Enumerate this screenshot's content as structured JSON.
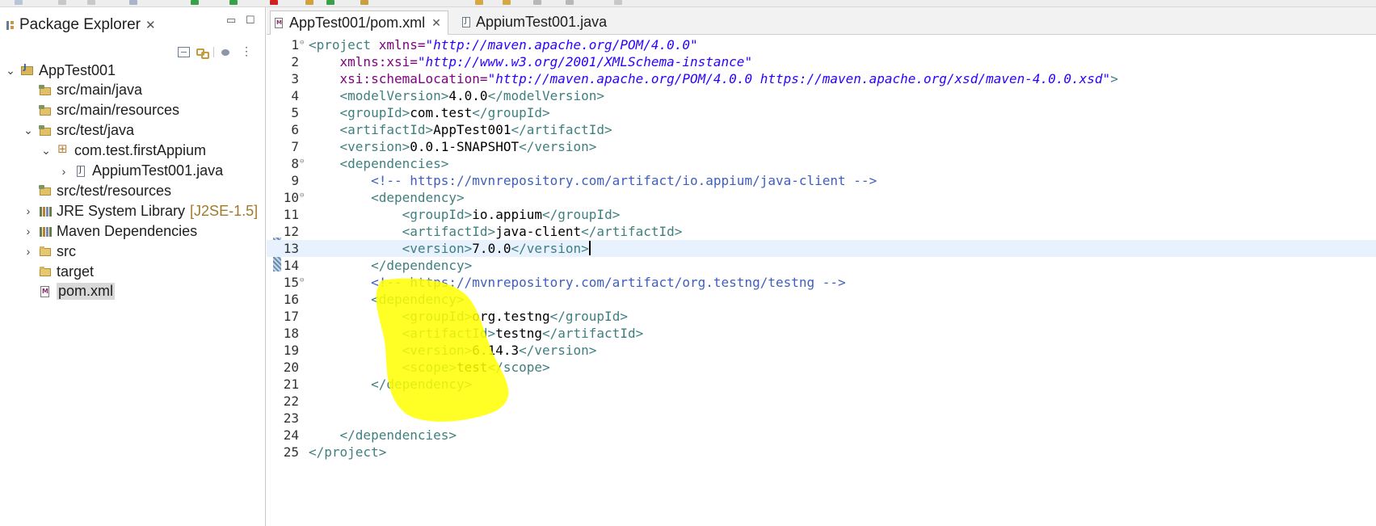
{
  "explorer": {
    "title": "Package Explorer",
    "close": "✕",
    "minimize": "▭",
    "maximize": "☐",
    "tree": [
      {
        "label": "AppTest001",
        "icon": "project-icon",
        "chevron": "⌄",
        "depth": 0
      },
      {
        "label": "src/main/java",
        "icon": "source-folder-icon",
        "chevron": "",
        "depth": 1
      },
      {
        "label": "src/main/resources",
        "icon": "source-folder-icon",
        "chevron": "",
        "depth": 1
      },
      {
        "label": "src/test/java",
        "icon": "source-folder-icon",
        "chevron": "⌄",
        "depth": 1
      },
      {
        "label": "com.test.firstAppium",
        "icon": "package-icon",
        "chevron": "⌄",
        "depth": 2
      },
      {
        "label": "AppiumTest001.java",
        "icon": "java-file-icon",
        "chevron": "›",
        "depth": 3
      },
      {
        "label": "src/test/resources",
        "icon": "source-folder-icon",
        "chevron": "",
        "depth": 1
      },
      {
        "label": "JRE System Library",
        "decoration": "[J2SE-1.5]",
        "icon": "library-icon",
        "chevron": "›",
        "depth": 1
      },
      {
        "label": "Maven Dependencies",
        "icon": "library-icon",
        "chevron": "›",
        "depth": 1
      },
      {
        "label": "src",
        "icon": "folder-icon",
        "chevron": "›",
        "depth": 1
      },
      {
        "label": "target",
        "icon": "folder-icon",
        "chevron": "",
        "depth": 1
      },
      {
        "label": "pom.xml",
        "icon": "xml-file-icon",
        "chevron": "",
        "depth": 1,
        "selected": true
      }
    ]
  },
  "editor": {
    "tabs": [
      {
        "label": "AppTest001/pom.xml",
        "close": "✕",
        "active": true
      },
      {
        "label": "AppiumTest001.java",
        "active": false
      }
    ],
    "current_line": 13,
    "lines": [
      {
        "n": "1",
        "fold": "⊖",
        "segs": [
          [
            "tg",
            "<project "
          ],
          [
            "an",
            "xmlns="
          ],
          [
            "av",
            "\"http://maven.apache.org/POM/4.0.0\""
          ]
        ]
      },
      {
        "n": "2",
        "segs": [
          [
            "tx",
            "    "
          ],
          [
            "an",
            "xmlns:xsi="
          ],
          [
            "av",
            "\"http://www.w3.org/2001/XMLSchema-instance\""
          ]
        ]
      },
      {
        "n": "3",
        "segs": [
          [
            "tx",
            "    "
          ],
          [
            "an",
            "xsi:schemaLocation="
          ],
          [
            "av",
            "\"http://maven.apache.org/POM/4.0.0 https://maven.apache.org/xsd/maven-4.0.0.xsd\""
          ],
          [
            "tg",
            ">"
          ]
        ]
      },
      {
        "n": "4",
        "segs": [
          [
            "tx",
            "    "
          ],
          [
            "tg",
            "<modelVersion>"
          ],
          [
            "tx",
            "4.0.0"
          ],
          [
            "tg",
            "</modelVersion>"
          ]
        ]
      },
      {
        "n": "5",
        "segs": [
          [
            "tx",
            "    "
          ],
          [
            "tg",
            "<groupId>"
          ],
          [
            "tx",
            "com.test"
          ],
          [
            "tg",
            "</groupId>"
          ]
        ]
      },
      {
        "n": "6",
        "segs": [
          [
            "tx",
            "    "
          ],
          [
            "tg",
            "<artifactId>"
          ],
          [
            "tx",
            "AppTest001"
          ],
          [
            "tg",
            "</artifactId>"
          ]
        ]
      },
      {
        "n": "7",
        "segs": [
          [
            "tx",
            "    "
          ],
          [
            "tg",
            "<version>"
          ],
          [
            "tx",
            "0.0.1-SNAPSHOT"
          ],
          [
            "tg",
            "</version>"
          ]
        ]
      },
      {
        "n": "8",
        "fold": "⊖",
        "segs": [
          [
            "tx",
            "    "
          ],
          [
            "tg",
            "<dependencies>"
          ]
        ]
      },
      {
        "n": "9",
        "segs": [
          [
            "tx",
            "        "
          ],
          [
            "cm",
            "<!-- https://mvnrepository.com/artifact/io.appium/java-client -->"
          ]
        ]
      },
      {
        "n": "10",
        "fold": "⊖",
        "segs": [
          [
            "tx",
            "        "
          ],
          [
            "tg",
            "<dependency>"
          ]
        ]
      },
      {
        "n": "11",
        "segs": [
          [
            "tx",
            "            "
          ],
          [
            "tg",
            "<groupId>"
          ],
          [
            "tx",
            "io.appium"
          ],
          [
            "tg",
            "</groupId>"
          ]
        ]
      },
      {
        "n": "12",
        "segs": [
          [
            "tx",
            "            "
          ],
          [
            "tg",
            "<artifactId>"
          ],
          [
            "tx",
            "java-client"
          ],
          [
            "tg",
            "</artifactId>"
          ]
        ]
      },
      {
        "n": "13",
        "segs": [
          [
            "tx",
            "            "
          ],
          [
            "tg",
            "<version>"
          ],
          [
            "tx",
            "7.0.0"
          ],
          [
            "tg",
            "</version>"
          ]
        ],
        "caret": true
      },
      {
        "n": "14",
        "segs": [
          [
            "tx",
            "        "
          ],
          [
            "tg",
            "</dependency>"
          ]
        ]
      },
      {
        "n": "15",
        "fold": "⊖",
        "segs": [
          [
            "tx",
            "        "
          ],
          [
            "cm",
            "<!-- https://mvnrepository.com/artifact/org.testng/testng -->"
          ]
        ]
      },
      {
        "n": "16",
        "segs": [
          [
            "tx",
            "        "
          ],
          [
            "tg",
            "<dependency>"
          ]
        ]
      },
      {
        "n": "17",
        "segs": [
          [
            "tx",
            "            "
          ],
          [
            "tg",
            "<groupId>"
          ],
          [
            "tx",
            "org.testng"
          ],
          [
            "tg",
            "</groupId>"
          ]
        ]
      },
      {
        "n": "18",
        "segs": [
          [
            "tx",
            "            "
          ],
          [
            "tg",
            "<artifactId>"
          ],
          [
            "tx",
            "testng"
          ],
          [
            "tg",
            "</artifactId>"
          ]
        ]
      },
      {
        "n": "19",
        "segs": [
          [
            "tx",
            "            "
          ],
          [
            "tg",
            "<version>"
          ],
          [
            "tx",
            "6.14.3"
          ],
          [
            "tg",
            "</version>"
          ]
        ]
      },
      {
        "n": "20",
        "segs": [
          [
            "tx",
            "            "
          ],
          [
            "tg",
            "<scope>"
          ],
          [
            "tx",
            "test"
          ],
          [
            "tg",
            "</scope>"
          ]
        ]
      },
      {
        "n": "21",
        "segs": [
          [
            "tx",
            "        "
          ],
          [
            "tg",
            "</dependency>"
          ]
        ]
      },
      {
        "n": "22",
        "segs": []
      },
      {
        "n": "23",
        "segs": []
      },
      {
        "n": "24",
        "segs": [
          [
            "tx",
            "    "
          ],
          [
            "tg",
            "</dependencies>"
          ]
        ]
      },
      {
        "n": "25",
        "segs": [
          [
            "tg",
            "</project>"
          ]
        ]
      }
    ]
  },
  "colors": {
    "highlight": "#ffff00",
    "tag": "#3f7f7f",
    "attribute_name": "#7f007f",
    "attribute_value": "#2a00ff",
    "comment": "#3f5fbf",
    "current_line": "#e8f2fe"
  }
}
